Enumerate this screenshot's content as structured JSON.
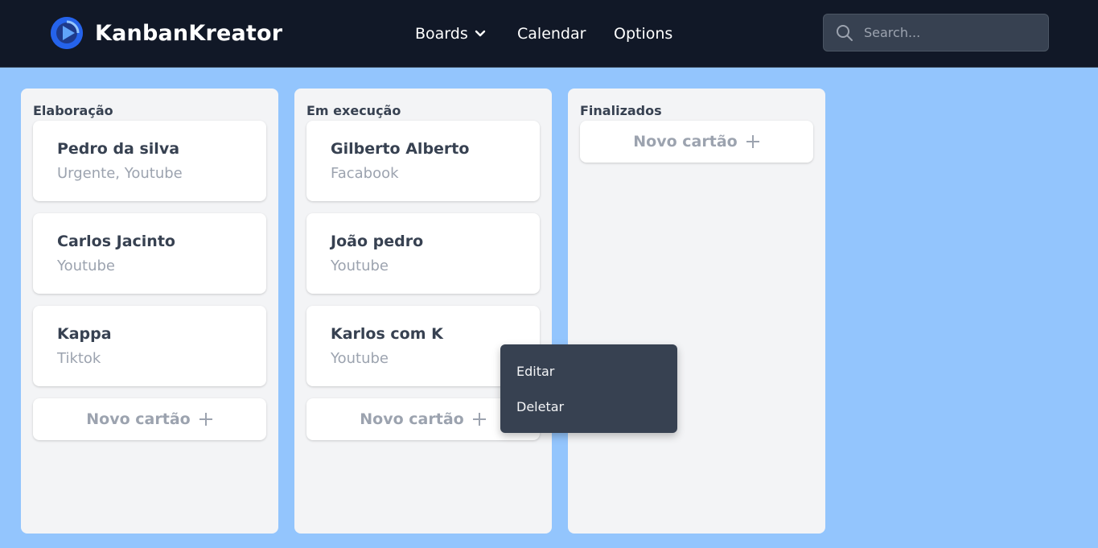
{
  "header": {
    "app_name": "KanbanKreator",
    "nav": {
      "boards": "Boards",
      "calendar": "Calendar",
      "options": "Options"
    },
    "search": {
      "placeholder": "Search...",
      "value": ""
    }
  },
  "columns": [
    {
      "title": "Elaboração",
      "cards": [
        {
          "title": "Pedro da silva",
          "tags": "Urgente, Youtube"
        },
        {
          "title": "Carlos Jacinto",
          "tags": "Youtube"
        },
        {
          "title": "Kappa",
          "tags": "Tiktok"
        }
      ],
      "new_card_label": "Novo cartão"
    },
    {
      "title": "Em execução",
      "cards": [
        {
          "title": "Gilberto Alberto",
          "tags": "Facabook"
        },
        {
          "title": "João pedro",
          "tags": "Youtube"
        },
        {
          "title": "Karlos com K",
          "tags": "Youtube"
        }
      ],
      "new_card_label": "Novo cartão"
    },
    {
      "title": "Finalizados",
      "cards": [],
      "new_card_label": "Novo cartão"
    }
  ],
  "context_menu": {
    "edit": "Editar",
    "delete": "Deletar"
  },
  "colors": {
    "navbar": "#111827",
    "board_background": "#93c5fd",
    "column_background": "#f3f4f6",
    "logo": "#1d4ed8",
    "menu_background": "#374151"
  },
  "icons": {
    "logo": "play-logo-icon",
    "boards_dropdown": "chevron-down-icon",
    "search": "search-icon",
    "add": "plus-icon"
  }
}
